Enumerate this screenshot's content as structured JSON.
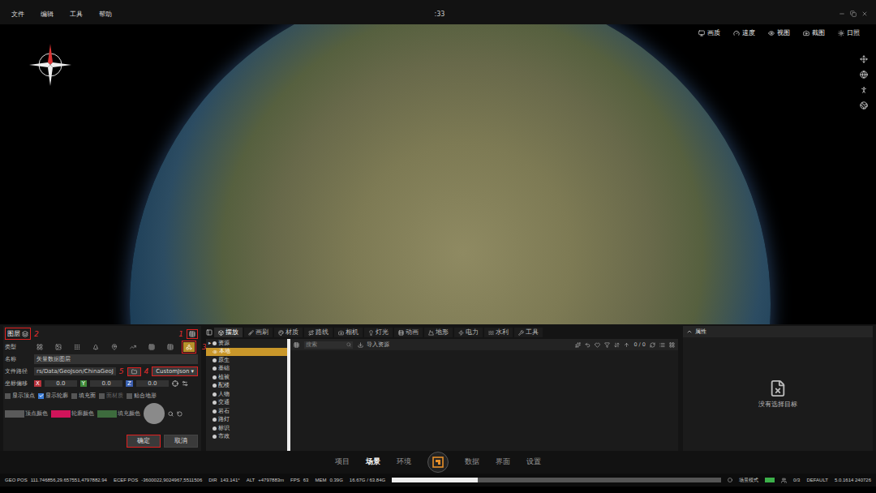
{
  "menu": [
    {
      "label": "文件"
    },
    {
      "label": "编辑"
    },
    {
      "label": "工具"
    },
    {
      "label": "帮助"
    }
  ],
  "window": {
    "title": ":33"
  },
  "view_tools": [
    {
      "label": "画质"
    },
    {
      "label": "速度"
    },
    {
      "label": "视图"
    },
    {
      "label": "截图"
    },
    {
      "label": "日照"
    }
  ],
  "layer_panel": {
    "title": "图层",
    "title_marker": "2",
    "add_marker": "1",
    "type_label": "类型",
    "types": [
      {
        "selected": false
      },
      {
        "selected": false
      },
      {
        "selected": false
      },
      {
        "selected": false
      },
      {
        "selected": false
      },
      {
        "selected": false
      },
      {
        "selected": false
      },
      {
        "selected": false
      },
      {
        "selected": true
      }
    ],
    "type_marker": "3",
    "name_label": "名称",
    "name_value": "矢量数据图层",
    "path_label": "文件路径",
    "path_value": "rs/Data/GeoJson/ChinaGeoJ",
    "folder_marker": "5",
    "format": "CustomJson",
    "format_arrow": "▾",
    "format_marker": "4",
    "offset_label": "坐标偏移",
    "offsets": [
      {
        "axis": "X",
        "value": "0.0",
        "color": "#b8323a"
      },
      {
        "axis": "Y",
        "value": "0.0",
        "color": "#3f8a3a"
      },
      {
        "axis": "Z",
        "value": "0.0",
        "color": "#3a5fb0"
      }
    ],
    "options": [
      {
        "label": "显示顶点",
        "checked": false,
        "disabled": false
      },
      {
        "label": "显示轮廓",
        "checked": true,
        "disabled": false
      },
      {
        "label": "填充面",
        "checked": false,
        "disabled": false
      },
      {
        "label": "面材质",
        "checked": false,
        "disabled": true
      },
      {
        "label": "贴合地形",
        "checked": false,
        "disabled": false
      }
    ],
    "colors": [
      {
        "label": "顶点颜色",
        "color": "#5a5a5a"
      },
      {
        "label": "轮廓颜色",
        "color": "#d0145a"
      },
      {
        "label": "填充颜色",
        "color": "#3d6b3d"
      }
    ],
    "buttons": [
      {
        "label": "确定",
        "highlighted": true
      },
      {
        "label": "取消",
        "highlighted": false
      }
    ]
  },
  "assets": {
    "tabs": [
      {
        "label": "摆放",
        "selected": true
      },
      {
        "label": "画刷",
        "selected": false
      },
      {
        "label": "材质",
        "selected": false
      },
      {
        "label": "路线",
        "selected": false
      },
      {
        "label": "相机",
        "selected": false
      },
      {
        "label": "灯光",
        "selected": false
      },
      {
        "label": "动画",
        "selected": false
      },
      {
        "label": "地形",
        "selected": false
      },
      {
        "label": "电力",
        "selected": false
      },
      {
        "label": "水利",
        "selected": false
      },
      {
        "label": "工具",
        "selected": false
      }
    ],
    "tree": [
      {
        "label": "资源",
        "expander": "▸",
        "selected": false
      },
      {
        "label": "本地",
        "expander": "",
        "selected": true
      },
      {
        "label": "原生",
        "expander": "",
        "selected": false
      },
      {
        "label": "基础",
        "expander": "",
        "selected": false
      },
      {
        "label": "植被",
        "expander": "",
        "selected": false
      },
      {
        "label": "配楼",
        "expander": "",
        "selected": false
      },
      {
        "label": "人物",
        "expander": "",
        "selected": false
      },
      {
        "label": "交通",
        "expander": "",
        "selected": false
      },
      {
        "label": "岩石",
        "expander": "",
        "selected": false
      },
      {
        "label": "路灯",
        "expander": "",
        "selected": false
      },
      {
        "label": "标识",
        "expander": "",
        "selected": false
      },
      {
        "label": "市政",
        "expander": "",
        "selected": false
      }
    ],
    "search_placeholder": "搜索",
    "import_label": "导入资源",
    "count": "0 / 0"
  },
  "properties": {
    "title": "属性",
    "empty": "没有选择目标"
  },
  "nav": [
    {
      "label": "项目",
      "selected": false
    },
    {
      "label": "场景",
      "selected": true
    },
    {
      "label": "环境",
      "selected": false
    },
    {
      "label": "数据",
      "selected": false
    },
    {
      "label": "界面",
      "selected": false
    },
    {
      "label": "设置",
      "selected": false
    }
  ],
  "status": {
    "segments": [
      {
        "label": "GEO POS",
        "value": "111.746856,29.657551,4797882.94"
      },
      {
        "label": "ECEF POS",
        "value": "-3600022,9024967,5511506"
      },
      {
        "label": "DIR",
        "value": "143.141°"
      },
      {
        "label": "ALT",
        "value": "+4797883m"
      },
      {
        "label": "FPS",
        "value": "63"
      },
      {
        "label": "MEM",
        "value": "0.39G"
      }
    ],
    "memory": "16.67G / 63.84G",
    "memory_level": 0.26,
    "mode_label": "场景模式",
    "mode_on": true,
    "mode_count": "0/3",
    "profile": "DEFAULT",
    "version": "5.0.1614 240726"
  }
}
